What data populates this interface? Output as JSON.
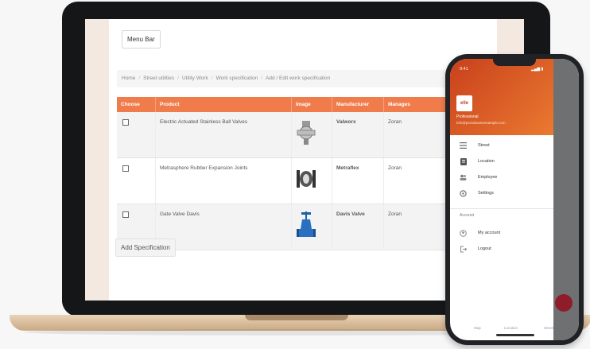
{
  "laptop": {
    "menu_bar": "Menu Bar",
    "breadcrumb": [
      "Home",
      "Street utilities",
      "Utility Work",
      "Work specification",
      "Add / Edit work specification"
    ],
    "table": {
      "headers": [
        "Choose",
        "Product",
        "Image",
        "Manufacturer",
        "Manages"
      ],
      "rows": [
        {
          "product": "Electric Actuated Stainless Ball Valves",
          "manufacturer": "Valworx",
          "manages": "Zoran"
        },
        {
          "product": "Metrasphere Rubber Expansion Joints",
          "manufacturer": "Metraflex",
          "manages": "Zoran"
        },
        {
          "product": "Gate Valve Davis",
          "manufacturer": "Davis Valve",
          "manages": "Zoran"
        }
      ]
    },
    "add_button": "Add Specification"
  },
  "phone": {
    "status_time": "9:41",
    "drawer_logo": "elle",
    "drawer_name": "Professional",
    "drawer_email": "info@pecialnameexample.com",
    "nav_items": [
      {
        "label": "Street",
        "icon": "list-icon"
      },
      {
        "label": "Location",
        "icon": "location-icon"
      },
      {
        "label": "Employee",
        "icon": "people-icon"
      },
      {
        "label": "Settings",
        "icon": "gear-icon"
      }
    ],
    "account_label": "Account",
    "account_items": [
      {
        "label": "My account",
        "icon": "account-icon"
      },
      {
        "label": "Logout",
        "icon": "logout-icon"
      }
    ],
    "bottom_nav": [
      "Map",
      "Location",
      "Street"
    ]
  },
  "colors": {
    "table_header": "#f07c4c",
    "drawer_header": "#d4552a",
    "fab": "#8e1c2a",
    "laptop_frame": "#151618"
  }
}
